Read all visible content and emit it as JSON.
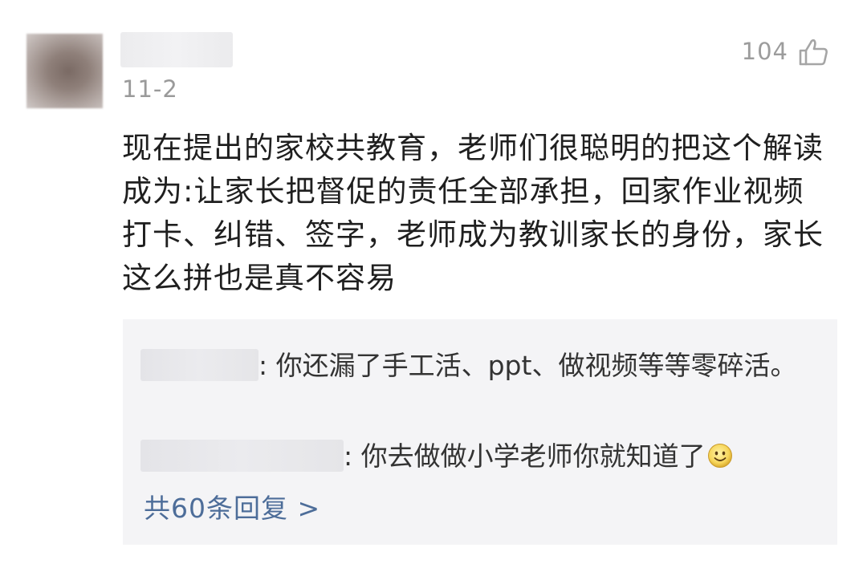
{
  "comment": {
    "date": "11-2",
    "likes": "104",
    "text": "现在提出的家校共教育，老师们很聪明的把这个解读成为:让家长把督促的责任全部承担，回家作业视频打卡、纠错、签字，老师成为教训家长的身份，家长这么拼也是真不容易"
  },
  "replies": [
    {
      "text": ": 你还漏了手工活、ppt、做视频等等零碎活。"
    },
    {
      "text": ": 你去做做小学老师你就知道了",
      "emoji": "smile-emoji"
    }
  ],
  "replies_footer": {
    "label": "共60条回复 >"
  },
  "colors": {
    "link": "#4d6d99",
    "meta": "#9a9a9a",
    "text": "#1f1f1f",
    "reply_bg": "#f4f4f6"
  },
  "icons": {
    "like": "thumbs-up-icon",
    "emoji": "smile-emoji-icon"
  }
}
